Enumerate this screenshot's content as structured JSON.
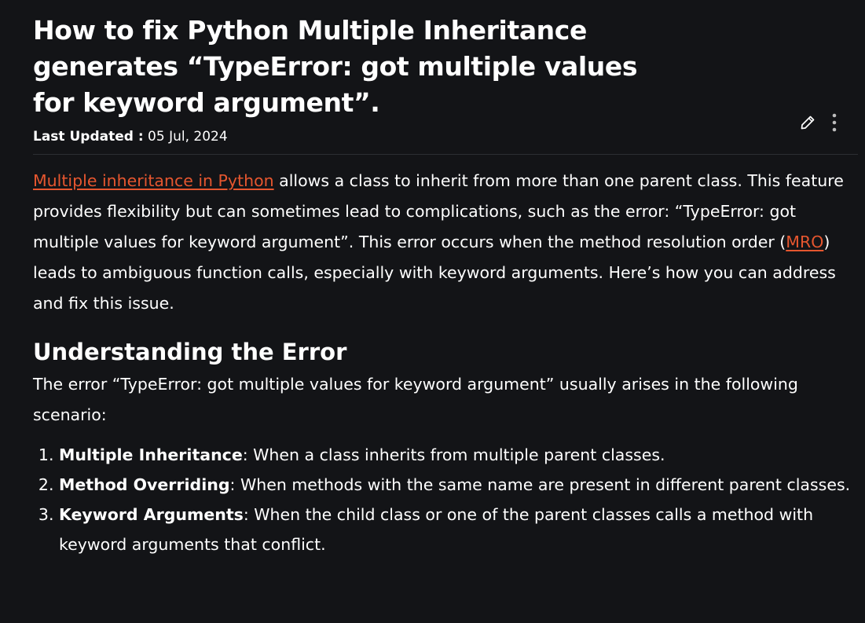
{
  "article": {
    "title": "How to fix Python Multiple Inheritance generates “TypeError: got multiple values for keyword argument”.",
    "last_updated_label": "Last Updated :",
    "last_updated_date": "05 Jul, 2024",
    "actions": {
      "edit_icon": "pencil-icon",
      "more_icon": "kebab-icon"
    },
    "intro": {
      "link1": "Multiple inheritance in Python",
      "text1": " allows a class to inherit from more than one parent class. This feature provides flexibility but can sometimes lead to complications, such as the error: “TypeError: got multiple values for keyword argument”. This error occurs when the method resolution order (",
      "link2": "MRO",
      "text2": ") leads to ambiguous function calls, especially with keyword arguments. Here’s how you can address and fix this issue."
    },
    "section": {
      "heading": "Understanding the Error",
      "paragraph": "The error “TypeError: got multiple values for keyword argument” usually arises in the following scenario:",
      "items": [
        {
          "term": "Multiple Inheritance",
          "desc": ": When a class inherits from multiple parent classes."
        },
        {
          "term": "Method Overriding",
          "desc": ": When methods with the same name are present in different parent classes."
        },
        {
          "term": "Keyword Arguments",
          "desc": ": When the child class or one of the parent classes calls a method with keyword arguments that conflict."
        }
      ]
    },
    "colors": {
      "background": "#131417",
      "link": "#e5562f",
      "text": "#ffffff"
    }
  }
}
